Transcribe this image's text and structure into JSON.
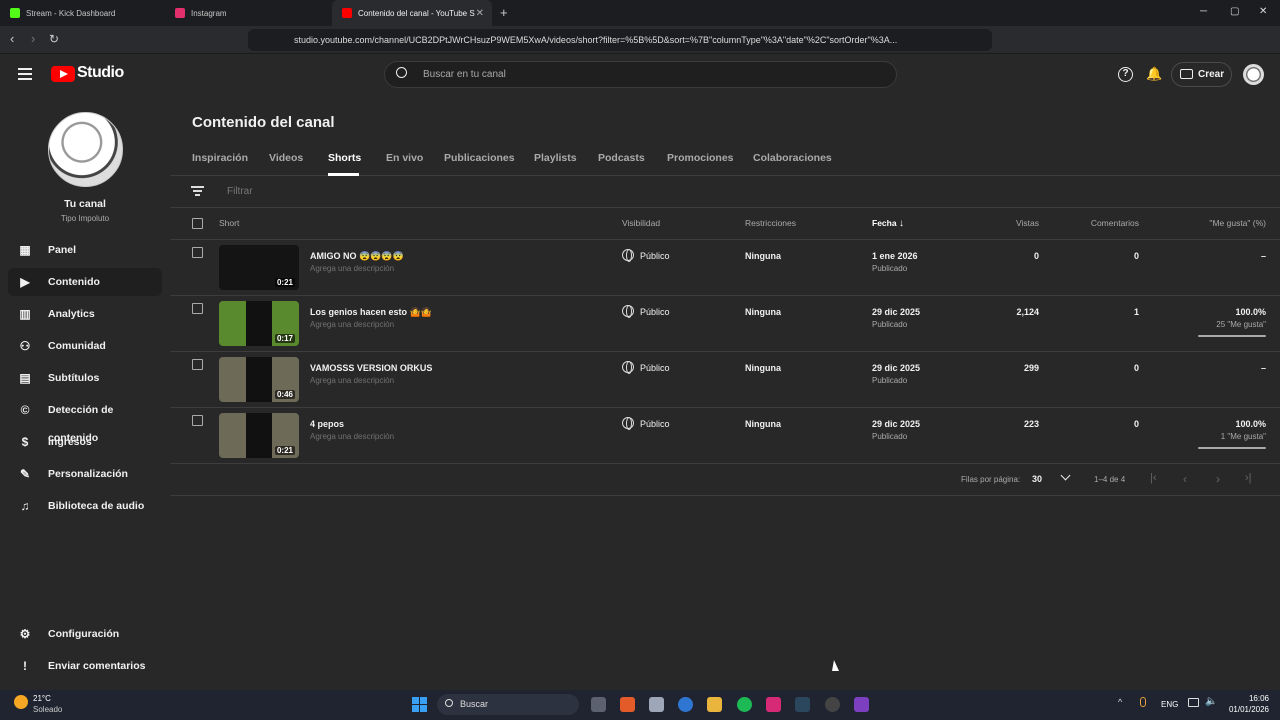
{
  "browser": {
    "tabs": [
      {
        "label": "Stream - Kick Dashboard",
        "favicon_color": "#53fc18"
      },
      {
        "label": "Instagram",
        "favicon_color": "#e1306c"
      },
      {
        "label": "Contenido del canal - YouTube S",
        "favicon_color": "#ff0000"
      }
    ],
    "new_tab": "+",
    "url": "studio.youtube.com/channel/UCB2DPtJWrCHsuzP9WEM5XwA/videos/short?filter=%5B%5D&sort=%7B\"columnType\"%3A\"date\"%2C\"sortOrder\"%3A...",
    "win_min": "─",
    "win_max": "▢",
    "win_close": "✕"
  },
  "header": {
    "logo_text": "Studio",
    "search_placeholder": "Buscar en tu canal",
    "create_label": "Crear"
  },
  "sidebar": {
    "channel_name": "Tu canal",
    "channel_handle": "Tipo Impoluto",
    "items": [
      {
        "label": "Panel",
        "icon": "dashboard-icon",
        "glyph": "▦"
      },
      {
        "label": "Contenido",
        "icon": "content-icon",
        "glyph": "▶"
      },
      {
        "label": "Analytics",
        "icon": "analytics-icon",
        "glyph": "▥"
      },
      {
        "label": "Comunidad",
        "icon": "community-icon",
        "glyph": "⚇"
      },
      {
        "label": "Subtítulos",
        "icon": "subtitles-icon",
        "glyph": "▤"
      },
      {
        "label": "Detección de contenido",
        "icon": "copyright-icon",
        "glyph": "©"
      },
      {
        "label": "Ingresos",
        "icon": "earn-icon",
        "glyph": "$"
      },
      {
        "label": "Personalización",
        "icon": "customization-icon",
        "glyph": "✎"
      },
      {
        "label": "Biblioteca de audio",
        "icon": "audio-library-icon",
        "glyph": "♫"
      }
    ],
    "bottom": [
      {
        "label": "Configuración",
        "icon": "settings-icon",
        "glyph": "⚙"
      },
      {
        "label": "Enviar comentarios",
        "icon": "feedback-icon",
        "glyph": "!"
      }
    ]
  },
  "main": {
    "title": "Contenido del canal",
    "tabs": [
      "Inspiración",
      "Videos",
      "Shorts",
      "En vivo",
      "Publicaciones",
      "Playlists",
      "Podcasts",
      "Promociones",
      "Colaboraciones"
    ],
    "active_tab": "Shorts",
    "filter_placeholder": "Filtrar",
    "columns": {
      "short": "Short",
      "visibility": "Visibilidad",
      "restrictions": "Restricciones",
      "date": "Fecha",
      "views": "Vistas",
      "comments": "Comentarios",
      "likes": "\"Me gusta\" (%)"
    },
    "sort_arrow": "↓",
    "rows": [
      {
        "title": "AMIGO NO 😨😨😨😨",
        "desc": "Agrega una descripción",
        "duration": "0:21",
        "visibility": "Público",
        "restrictions": "Ninguna",
        "date": "1 ene 2026",
        "status": "Publicado",
        "views": "0",
        "comments": "0",
        "likes": "–",
        "likes_sub": "",
        "like_ratio": null,
        "thumb": "#141414"
      },
      {
        "title": "Los genios hacen esto 🤷🤷",
        "desc": "Agrega una descripción",
        "duration": "0:17",
        "visibility": "Público",
        "restrictions": "Ninguna",
        "date": "29 dic 2025",
        "status": "Publicado",
        "views": "2,124",
        "comments": "1",
        "likes": "100.0%",
        "likes_sub": "25 \"Me gusta\"",
        "like_ratio": 1.0,
        "thumb": "#5a8a2e"
      },
      {
        "title": "VAMOSSS VERSION ORKUS",
        "desc": "Agrega una descripción",
        "duration": "0:46",
        "visibility": "Público",
        "restrictions": "Ninguna",
        "date": "29 dic 2025",
        "status": "Publicado",
        "views": "299",
        "comments": "0",
        "likes": "–",
        "likes_sub": "",
        "like_ratio": null,
        "thumb": "#6e6a58"
      },
      {
        "title": "4 pepos",
        "desc": "Agrega una descripción",
        "duration": "0:21",
        "visibility": "Público",
        "restrictions": "Ninguna",
        "date": "29 dic 2025",
        "status": "Publicado",
        "views": "223",
        "comments": "0",
        "likes": "100.0%",
        "likes_sub": "1 \"Me gusta\"",
        "like_ratio": 1.0,
        "thumb": "#6e6a58"
      }
    ],
    "pagination": {
      "rows_per_page_label": "Filas por página:",
      "rows_per_page": "30",
      "range": "1–4 de 4"
    }
  },
  "taskbar": {
    "weather_temp": "21°C",
    "weather_desc": "Soleado",
    "search_label": "Buscar",
    "lang": "ENG",
    "time": "16:06",
    "date": "01/01/2026"
  }
}
